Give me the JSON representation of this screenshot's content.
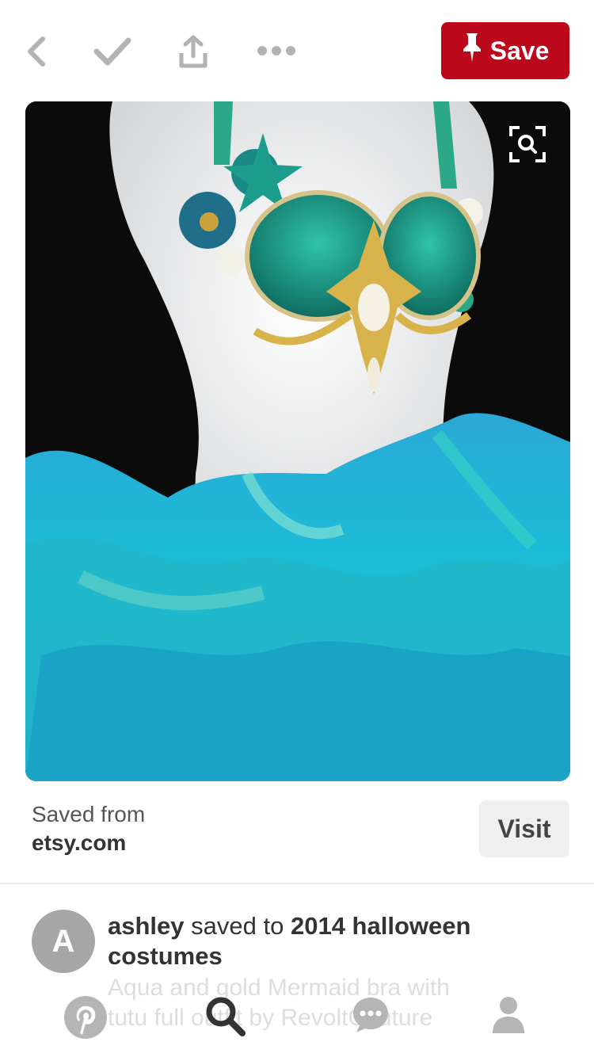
{
  "toolbar": {
    "back_icon": "chevron-left-icon",
    "check_icon": "checkmark-icon",
    "share_icon": "share-icon",
    "more_icon": "more-dots-icon",
    "save_label": "Save",
    "save_icon": "pin-icon",
    "save_color": "#bd081c"
  },
  "pin": {
    "image_icon": "visual-search-icon"
  },
  "source": {
    "label": "Saved from",
    "domain": "etsy.com",
    "visit_label": "Visit"
  },
  "saver": {
    "avatar_letter": "A",
    "user": "ashley",
    "connector": "saved to",
    "board": "2014 halloween costumes",
    "description": "Aqua and gold Mermaid bra with tutu full outfit by RevoltCouture"
  },
  "nav": {
    "items": [
      {
        "icon": "pinterest-logo-icon",
        "label": "Home"
      },
      {
        "icon": "search-icon",
        "label": "Search"
      },
      {
        "icon": "chat-bubble-icon",
        "label": "Notifications"
      },
      {
        "icon": "profile-icon",
        "label": "Profile"
      }
    ]
  }
}
